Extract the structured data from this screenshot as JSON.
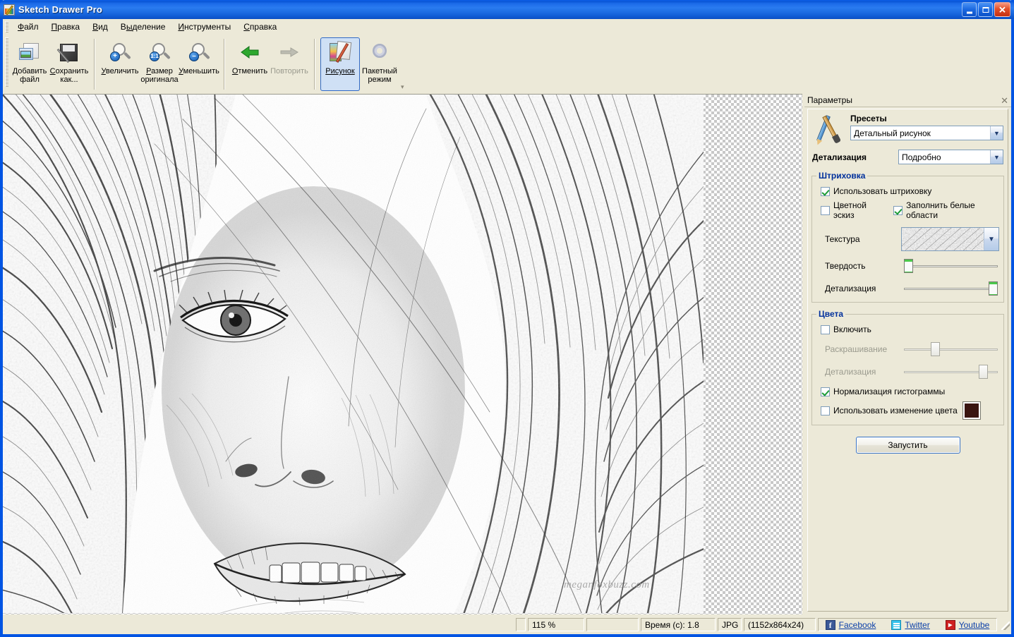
{
  "window": {
    "title": "Sketch Drawer Pro",
    "icon": "app-icon",
    "minimize": "_",
    "maximize": "□",
    "close": "✕"
  },
  "menu": {
    "items": [
      {
        "label": "Файл",
        "accel": "Ф"
      },
      {
        "label": "Правка",
        "accel": "П"
      },
      {
        "label": "Вид",
        "accel": "В"
      },
      {
        "label": "Выделение",
        "accel": "В"
      },
      {
        "label": "Инструменты",
        "accel": "И"
      },
      {
        "label": "Справка",
        "accel": "С"
      }
    ]
  },
  "toolbar": {
    "buttons": [
      {
        "label1": "Добавить",
        "label2": "файл",
        "icon": "add-file-icon",
        "state": "normal"
      },
      {
        "label1": "Сохранить",
        "label2": "как...",
        "icon": "save-as-icon",
        "state": "normal"
      },
      {
        "label1": "Увеличить",
        "label2": "",
        "icon": "zoom-in-icon",
        "state": "normal"
      },
      {
        "label1": "Размер",
        "label2": "оригинала",
        "icon": "zoom-original-icon",
        "state": "normal"
      },
      {
        "label1": "Уменьшить",
        "label2": "",
        "icon": "zoom-out-icon",
        "state": "normal"
      },
      {
        "label1": "Отменить",
        "label2": "",
        "icon": "undo-icon",
        "state": "normal"
      },
      {
        "label1": "Повторить",
        "label2": "",
        "icon": "redo-icon",
        "state": "disabled"
      },
      {
        "label1": "Рисунок",
        "label2": "",
        "icon": "picture-mode-icon",
        "state": "active"
      },
      {
        "label1": "Пакетный",
        "label2": "режим",
        "icon": "batch-mode-icon",
        "state": "normal"
      }
    ],
    "overflow": "▾"
  },
  "canvas": {
    "watermark": "meganfoxbuzz.com",
    "image_alt": "pencil-sketch-portrait"
  },
  "panel": {
    "title": "Параметры",
    "close": "✕",
    "presets": {
      "heading": "Пресеты",
      "value": "Детальный рисунок",
      "arrow": "▼"
    },
    "detail": {
      "label": "Детализация",
      "value": "Подробно",
      "arrow": "▼"
    },
    "hatching": {
      "legend": "Штриховка",
      "use_hatching": {
        "label": "Использовать штриховку",
        "checked": true
      },
      "color_sketch": {
        "label": "Цветной эскиз",
        "checked": false
      },
      "fill_white": {
        "label": "Заполнить белые области",
        "checked": true
      },
      "texture": {
        "label": "Текстура",
        "arrow": "▼"
      },
      "hardness": {
        "label": "Твердость",
        "value": 2
      },
      "detail": {
        "label": "Детализация",
        "value": 97
      }
    },
    "colors": {
      "legend": "Цвета",
      "enable": {
        "label": "Включить",
        "checked": false
      },
      "colorize": {
        "label": "Раскрашивание",
        "value": 34,
        "disabled": true
      },
      "detail": {
        "label": "Детализация",
        "value": 80,
        "disabled": true
      },
      "histogram": {
        "label": "Нормализация гистограммы",
        "checked": true
      },
      "color_change": {
        "label": "Использовать изменение цвета",
        "checked": false
      },
      "swatch_color": "#3a1510"
    },
    "run_button": "Запустить"
  },
  "statusbar": {
    "zoom": "115 %",
    "spacer": "",
    "time": "Время (с): 1.8",
    "format": "JPG",
    "dimensions": "(1152x864x24)",
    "social": [
      {
        "label": "Facebook",
        "icon": "facebook-icon"
      },
      {
        "label": "Twitter",
        "icon": "twitter-icon"
      },
      {
        "label": "Youtube",
        "icon": "youtube-icon"
      }
    ]
  },
  "colors": {
    "titlebar_blue": "#0a56d6",
    "panel_bg": "#ece9d8",
    "group_legend": "#00309c",
    "link": "#0b3fa8",
    "slider_accent": "#4cc94c"
  }
}
